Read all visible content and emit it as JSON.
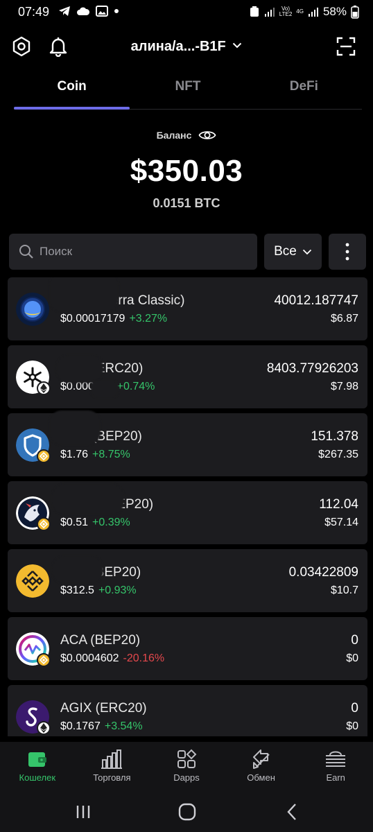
{
  "status_bar": {
    "time": "07:49",
    "battery": "58%",
    "net_top": "Vo)",
    "net_bottom": "LTE2",
    "net2": "4G"
  },
  "header": {
    "wallet_name": "алина/а...-B1F"
  },
  "tabs": [
    {
      "label": "Coin"
    },
    {
      "label": "NFT"
    },
    {
      "label": "DeFi"
    }
  ],
  "balance": {
    "label": "Баланс",
    "value": "$350.03",
    "btc": "0.0151 BTC"
  },
  "search": {
    "placeholder": "Поиск"
  },
  "filter": {
    "label": "Все"
  },
  "tokens": [
    {
      "name": "LUNC (Terra Classic)",
      "price": "$0.00017179",
      "change": "+3.27%",
      "amount": "40012.187747",
      "fiat": "$6.87"
    },
    {
      "name": "RPC (ERC20)",
      "price": "$0.000949",
      "change": "+0.74%",
      "amount": "8403.77926203",
      "fiat": "$7.98"
    },
    {
      "name": "TWT (BEP20)",
      "price": "$1.76",
      "change": "+8.75%",
      "amount": "151.378",
      "fiat": "$267.35"
    },
    {
      "name": "1INCH (BEP20)",
      "price": "$0.51",
      "change": "+0.39%",
      "amount": "112.04",
      "fiat": "$57.14"
    },
    {
      "name": "BNB (BEP20)",
      "price": "$312.5",
      "change": "+0.93%",
      "amount": "0.03422809",
      "fiat": "$10.7"
    },
    {
      "name": "ACA (BEP20)",
      "price": "$0.0004602",
      "change": "-20.16%",
      "amount": "0",
      "fiat": "$0"
    },
    {
      "name": "AGIX (ERC20)",
      "price": "$0.1767",
      "change": "+3.54%",
      "amount": "0",
      "fiat": "$0"
    }
  ],
  "bottom_nav": [
    {
      "label": "Кошелек"
    },
    {
      "label": "Торговля"
    },
    {
      "label": "Dapps"
    },
    {
      "label": "Обмен"
    },
    {
      "label": "Earn"
    }
  ],
  "colors": {
    "accent": "#6d6ce8",
    "positive": "#35c46a",
    "negative": "#e5484d",
    "card": "#1c1c1f"
  }
}
